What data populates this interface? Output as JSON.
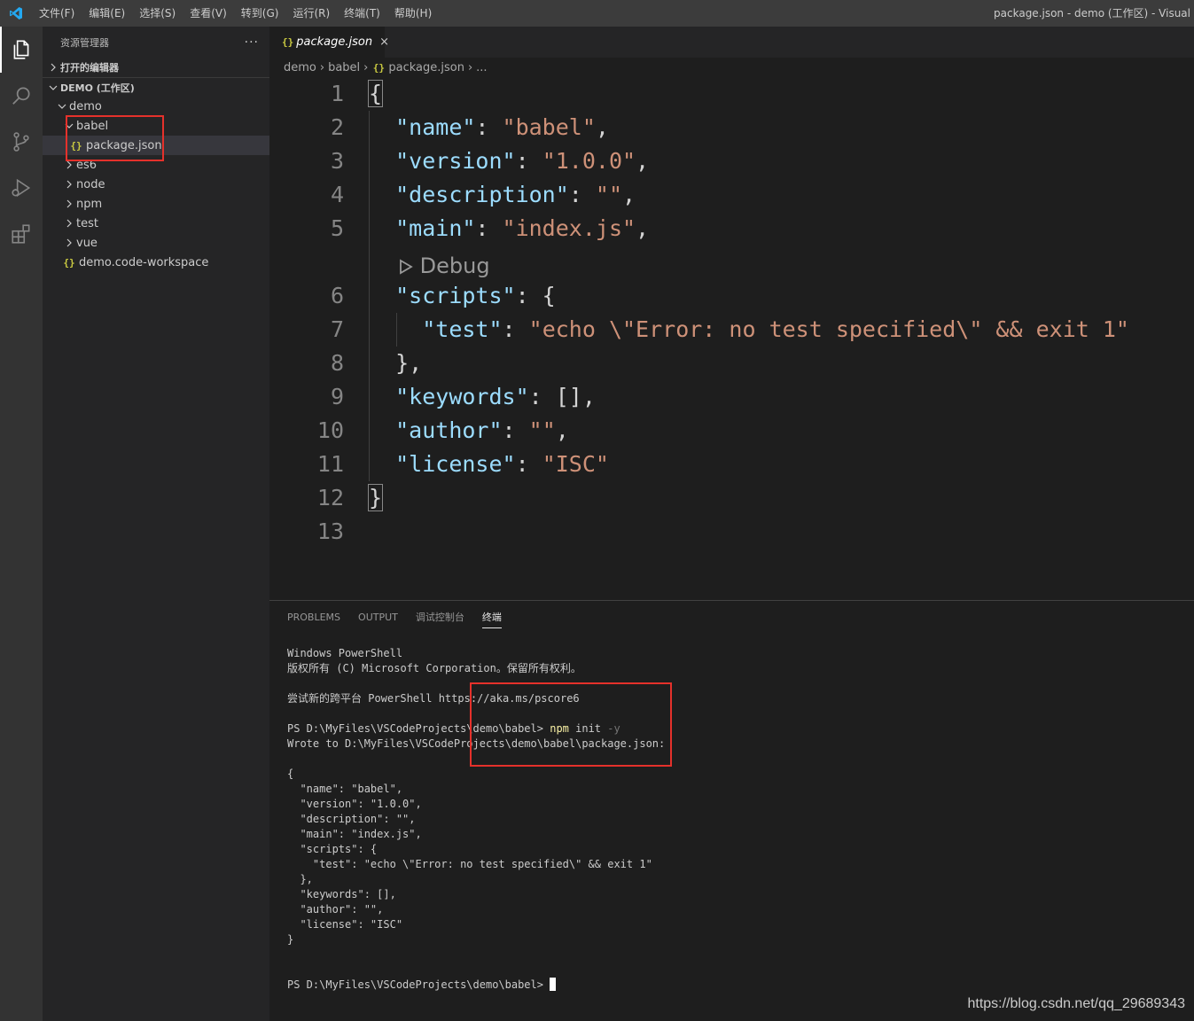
{
  "titlebar": {
    "menu": [
      "文件(F)",
      "编辑(E)",
      "选择(S)",
      "查看(V)",
      "转到(G)",
      "运行(R)",
      "终端(T)",
      "帮助(H)"
    ],
    "window_title": "package.json - demo (工作区) - Visual"
  },
  "activity_icons": [
    "explorer-icon",
    "search-icon",
    "source-control-icon",
    "run-debug-icon",
    "extensions-icon"
  ],
  "sidebar": {
    "title": "资源管理器",
    "more": "···",
    "open_editors": "打开的编辑器",
    "workspace": "DEMO (工作区)",
    "tree": {
      "root": "demo",
      "babel": "babel",
      "package_json": "package.json",
      "es6": "es6",
      "node": "node",
      "npm": "npm",
      "test": "test",
      "vue": "vue",
      "workspace_file": "demo.code-workspace"
    }
  },
  "editor": {
    "tab": {
      "label": "package.json",
      "close": "×"
    },
    "breadcrumb": {
      "p1": "demo",
      "p2": "babel",
      "p3": "package.json",
      "p4": "..."
    },
    "json_icon": "{}",
    "line_numbers": [
      "1",
      "2",
      "3",
      "4",
      "5",
      "6",
      "7",
      "8",
      "9",
      "10",
      "11",
      "12",
      "13"
    ],
    "codelens": "Debug",
    "code": {
      "open_brace": "{",
      "name_key": "\"name\"",
      "name_val": "\"babel\"",
      "version_key": "\"version\"",
      "version_val": "\"1.0.0\"",
      "description_key": "\"description\"",
      "description_val": "\"\"",
      "main_key": "\"main\"",
      "main_val": "\"index.js\"",
      "scripts_key": "\"scripts\"",
      "test_key": "\"test\"",
      "test_val": "\"echo \\\"Error: no test specified\\\" && exit 1\"",
      "scripts_close": "},",
      "keywords_key": "\"keywords\"",
      "keywords_val": "[]",
      "author_key": "\"author\"",
      "author_val": "\"\"",
      "license_key": "\"license\"",
      "license_val": "\"ISC\"",
      "close_brace": "}"
    }
  },
  "panel": {
    "tabs": [
      "PROBLEMS",
      "OUTPUT",
      "调试控制台",
      "终端"
    ],
    "terminal": {
      "l1": "Windows PowerShell",
      "l2": "版权所有 (C) Microsoft Corporation。保留所有权利。",
      "l3": "尝试新的跨平台 PowerShell https://aka.ms/pscore6",
      "prompt": "PS D:\\MyFiles\\VSCodeProjects\\demo\\babel> ",
      "cmd_npm": "npm",
      "cmd_init": " init ",
      "cmd_flag": "-y",
      "wrote": "Wrote to D:\\MyFiles\\VSCodeProjects\\demo\\babel\\package.json:",
      "j1": "{",
      "j2": "  \"name\": \"babel\",",
      "j3": "  \"version\": \"1.0.0\",",
      "j4": "  \"description\": \"\",",
      "j5": "  \"main\": \"index.js\",",
      "j6": "  \"scripts\": {",
      "j7": "    \"test\": \"echo \\\"Error: no test specified\\\" && exit 1\"",
      "j8": "  },",
      "j9": "  \"keywords\": [],",
      "j10": "  \"author\": \"\",",
      "j11": "  \"license\": \"ISC\"",
      "j12": "}",
      "final_prompt": "PS D:\\MyFiles\\VSCodeProjects\\demo\\babel> "
    }
  },
  "watermark": "https://blog.csdn.net/qq_29689343",
  "colors": {
    "json_key": "#9cdcfe",
    "json_string": "#ce9178",
    "json_icon": "#cbcb41",
    "highlight_box": "#e5312b",
    "vscode_blue": "#23a9f2"
  }
}
